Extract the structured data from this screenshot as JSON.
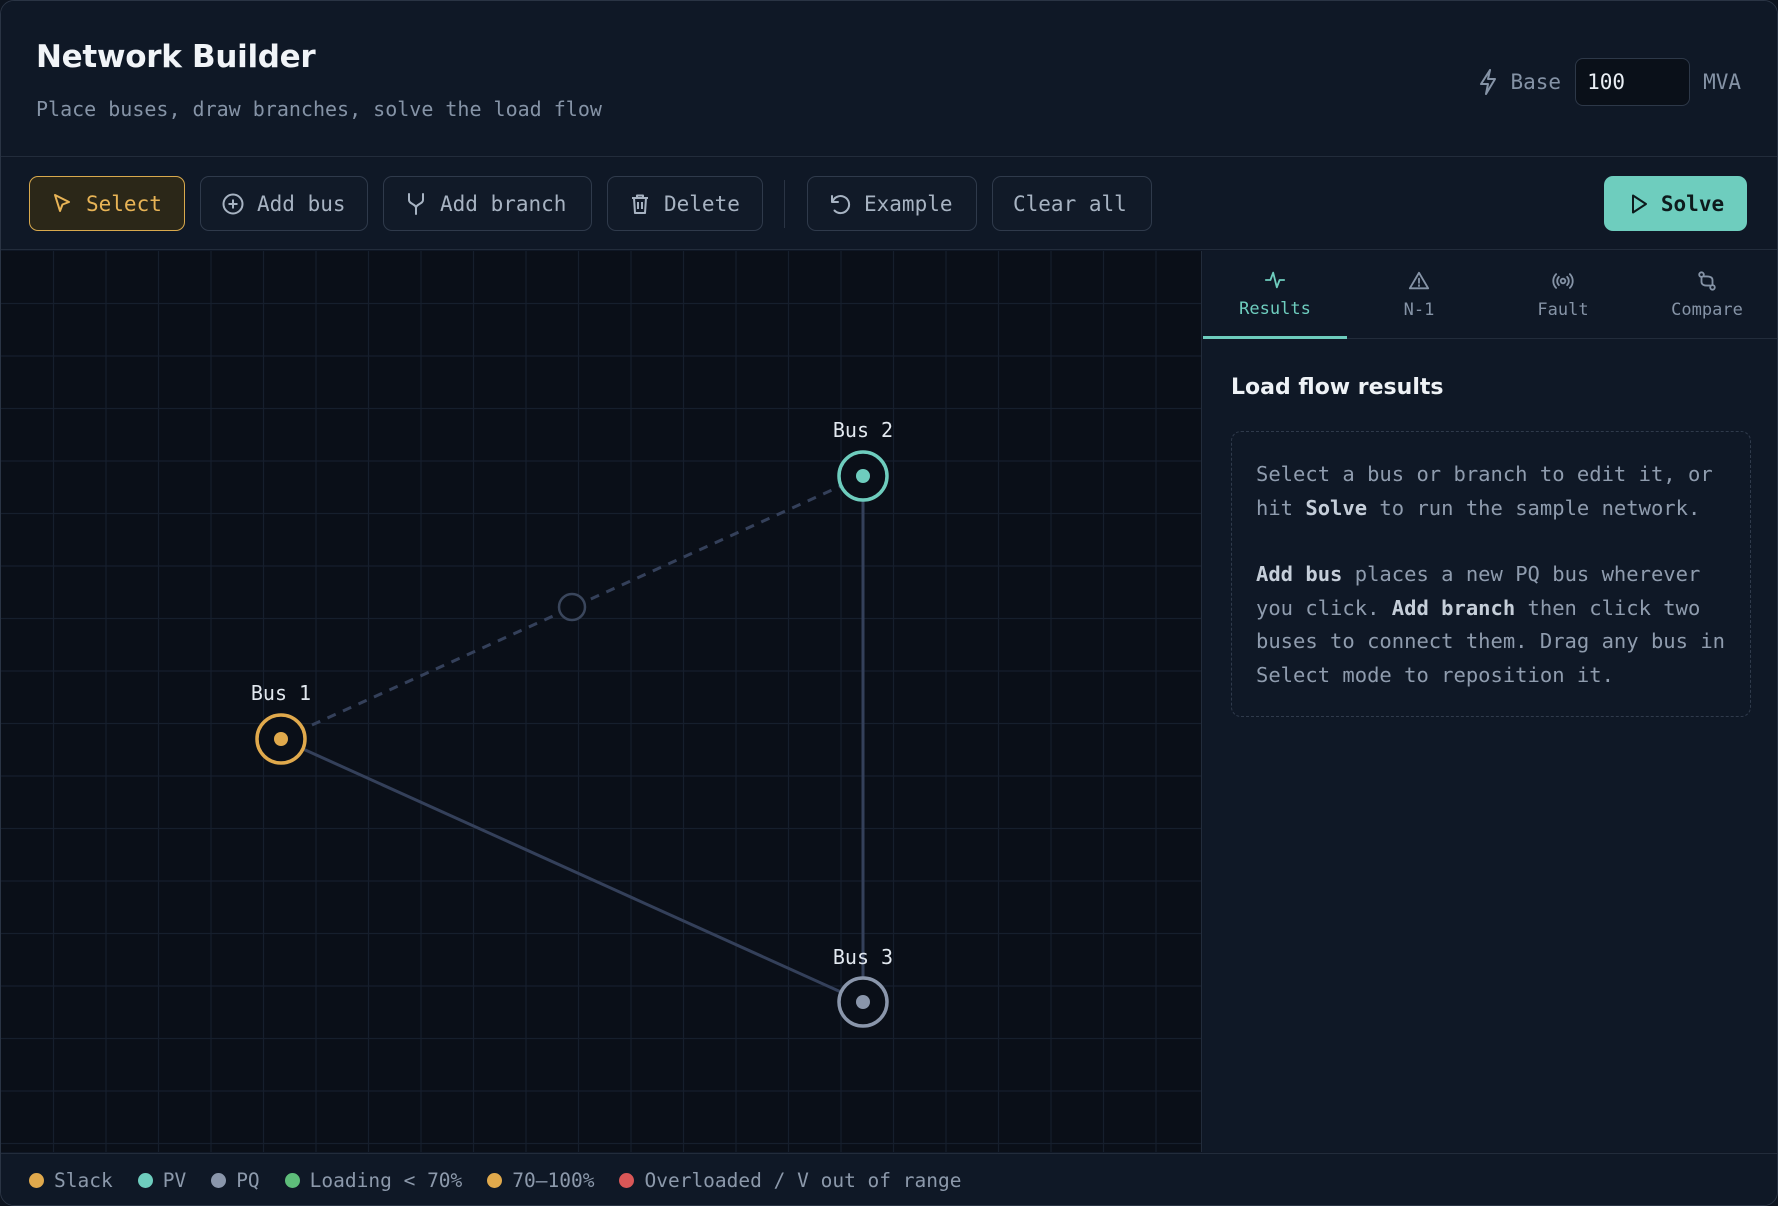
{
  "header": {
    "title": "Network Builder",
    "subtitle": "Place buses, draw branches, solve the load flow",
    "base_label": "Base",
    "base_value": "100",
    "base_unit": "MVA"
  },
  "toolbar": {
    "select": "Select",
    "add_bus": "Add bus",
    "add_branch": "Add branch",
    "delete": "Delete",
    "example": "Example",
    "clear_all": "Clear all",
    "solve": "Solve",
    "active_tool": "Select"
  },
  "network": {
    "buses": [
      {
        "label": "Bus 1",
        "type": "Slack"
      },
      {
        "label": "Bus 2",
        "type": "PV"
      },
      {
        "label": "Bus 3",
        "type": "PQ"
      }
    ],
    "branches": [
      {
        "from": "Bus 1",
        "to": "Bus 2",
        "style": "dashed"
      },
      {
        "from": "Bus 2",
        "to": "Bus 3",
        "style": "solid"
      },
      {
        "from": "Bus 1",
        "to": "Bus 3",
        "style": "solid"
      }
    ]
  },
  "panel": {
    "tabs": [
      {
        "label": "Results",
        "icon": "activity-icon",
        "active": true
      },
      {
        "label": "N-1",
        "icon": "warning-triangle-icon",
        "active": false
      },
      {
        "label": "Fault",
        "icon": "broadcast-icon",
        "active": false
      },
      {
        "label": "Compare",
        "icon": "git-compare-icon",
        "active": false
      }
    ],
    "title": "Load flow results",
    "hint": {
      "p1_a": "Select a bus or branch to edit it, or hit ",
      "p1_b": "Solve",
      "p1_c": " to run the sample network.",
      "p2_a": "Add bus",
      "p2_b": " places a new PQ bus wherever you click. ",
      "p2_c": "Add branch",
      "p2_d": " then click two buses to connect them. Drag any bus in Select mode to reposition it."
    }
  },
  "legend": [
    {
      "label": "Slack",
      "color": "#e0a94c"
    },
    {
      "label": "PV",
      "color": "#6ecdbe"
    },
    {
      "label": "PQ",
      "color": "#8a96ab"
    },
    {
      "label": "Loading < 70%",
      "color": "#5ebd7a"
    },
    {
      "label": "70–100%",
      "color": "#e0a94c"
    },
    {
      "label": "Overloaded / V out of range",
      "color": "#d95757"
    }
  ],
  "colors": {
    "accent": "#6ecdbe",
    "slack": "#e0a94c",
    "pv": "#6ecdbe",
    "pq": "#8a96ab",
    "branch": "#34405a"
  }
}
